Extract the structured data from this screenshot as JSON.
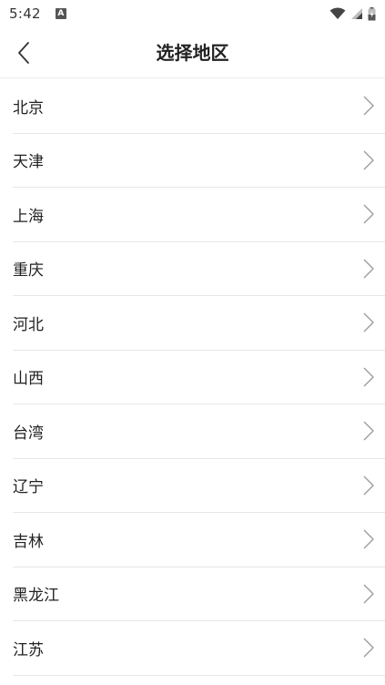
{
  "status_bar": {
    "time": "5:42",
    "notification_glyph": "A"
  },
  "header": {
    "title": "选择地区",
    "back_icon": "chevron-left-icon"
  },
  "regions": [
    {
      "label": "北京"
    },
    {
      "label": "天津"
    },
    {
      "label": "上海"
    },
    {
      "label": "重庆"
    },
    {
      "label": "河北"
    },
    {
      "label": "山西"
    },
    {
      "label": "台湾"
    },
    {
      "label": "辽宁"
    },
    {
      "label": "吉林"
    },
    {
      "label": "黑龙江"
    },
    {
      "label": "江苏"
    }
  ],
  "colors": {
    "divider": "#e6e6e6",
    "chevron": "#9a9a9a",
    "text": "#222222"
  }
}
